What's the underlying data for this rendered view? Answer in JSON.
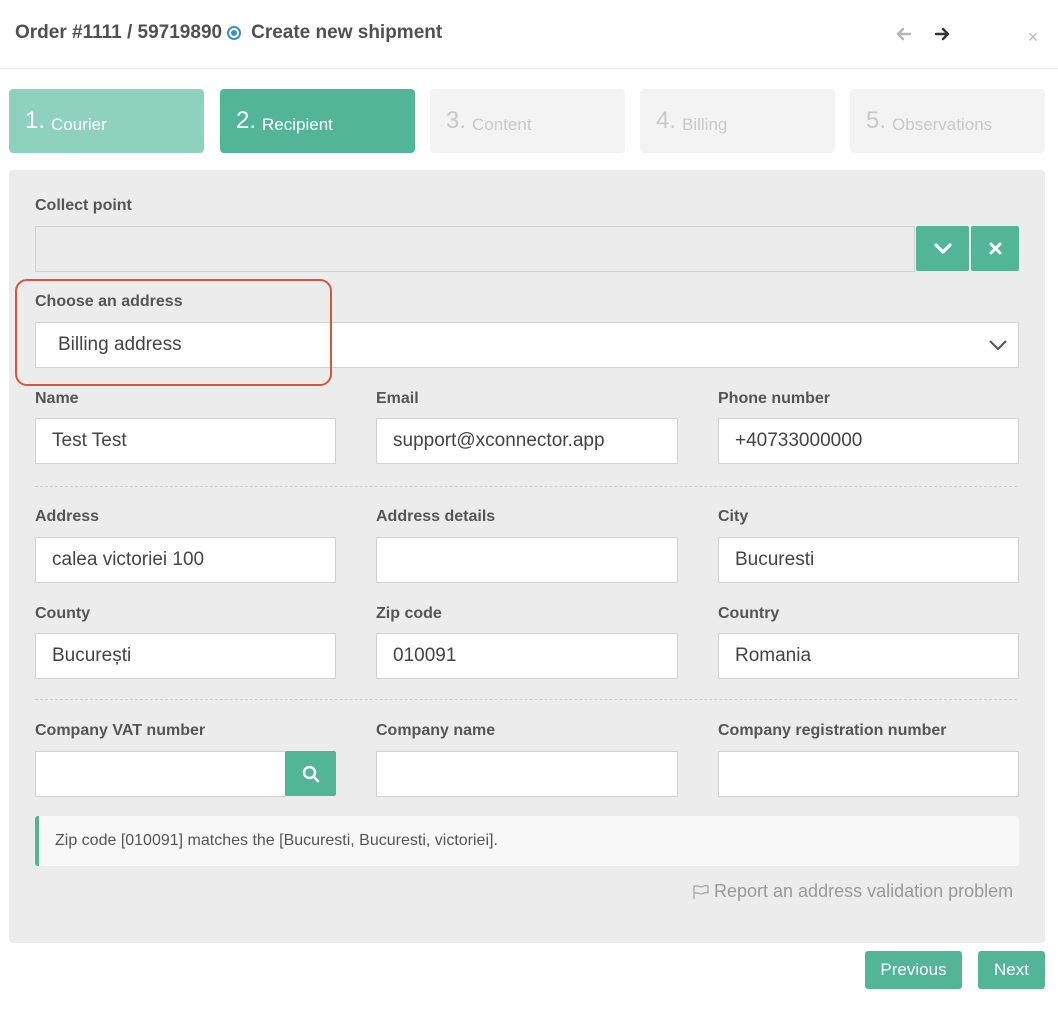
{
  "header": {
    "title": "Order #1111 / 59719890",
    "subtitle": "Create new shipment",
    "prev_icon": "arrow-left-icon",
    "next_icon": "arrow-right-icon",
    "close_label": "×"
  },
  "steps": [
    {
      "num": "1.",
      "label": "Courier",
      "state": "done"
    },
    {
      "num": "2.",
      "label": "Recipient",
      "state": "active"
    },
    {
      "num": "3.",
      "label": "Content",
      "state": "todo"
    },
    {
      "num": "4.",
      "label": "Billing",
      "state": "todo"
    },
    {
      "num": "5.",
      "label": "Observations",
      "state": "todo"
    }
  ],
  "collect_point": {
    "label": "Collect point",
    "value": ""
  },
  "address_choice": {
    "label": "Choose an address",
    "value": "Billing address"
  },
  "fields": {
    "name": {
      "label": "Name",
      "value": "Test Test"
    },
    "email": {
      "label": "Email",
      "value": "support@xconnector.app"
    },
    "phone": {
      "label": "Phone number",
      "value": "+40733000000"
    },
    "address": {
      "label": "Address",
      "value": "calea victoriei 100"
    },
    "address_details": {
      "label": "Address details",
      "value": ""
    },
    "city": {
      "label": "City",
      "value": "Bucuresti"
    },
    "county": {
      "label": "County",
      "value": "București"
    },
    "zip": {
      "label": "Zip code",
      "value": "010091"
    },
    "country": {
      "label": "Country",
      "value": "Romania"
    },
    "vat": {
      "label": "Company VAT number",
      "value": ""
    },
    "company_name": {
      "label": "Company name",
      "value": ""
    },
    "company_reg": {
      "label": "Company registration number",
      "value": ""
    }
  },
  "alert": {
    "text": "Zip code [010091] matches the [Bucuresti, Bucuresti, victoriei]."
  },
  "report": {
    "text": "Report an address validation problem"
  },
  "footer": {
    "previous": "Previous",
    "next": "Next"
  },
  "colors": {
    "accent": "#52b595",
    "accent_light": "#8fd1bf",
    "highlight": "#d9553e",
    "link_icon": "#3a8fd0"
  }
}
